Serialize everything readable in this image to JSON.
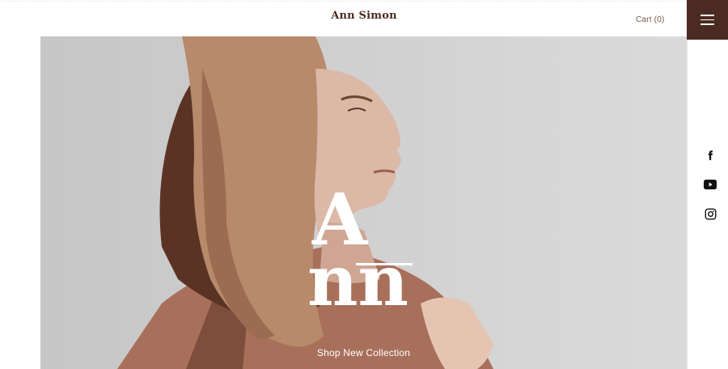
{
  "header": {
    "brand": "Ann Simon",
    "cart_label": "Cart (0)",
    "menu_icon": "hamburger-menu-icon"
  },
  "hero": {
    "title_line1": "A",
    "title_line2": "nn",
    "cta_label": "Shop New Collection"
  },
  "social": [
    {
      "name": "facebook-icon"
    },
    {
      "name": "youtube-icon"
    },
    {
      "name": "instagram-icon"
    }
  ],
  "colors": {
    "brand": "#4a2a22",
    "accent": "#4a2a22",
    "cart_text": "#7a5446",
    "hero_bg": "#d0d0d0",
    "jacket": "#a8705a",
    "hair": "#b88a6c",
    "skin": "#dcb8a6"
  }
}
